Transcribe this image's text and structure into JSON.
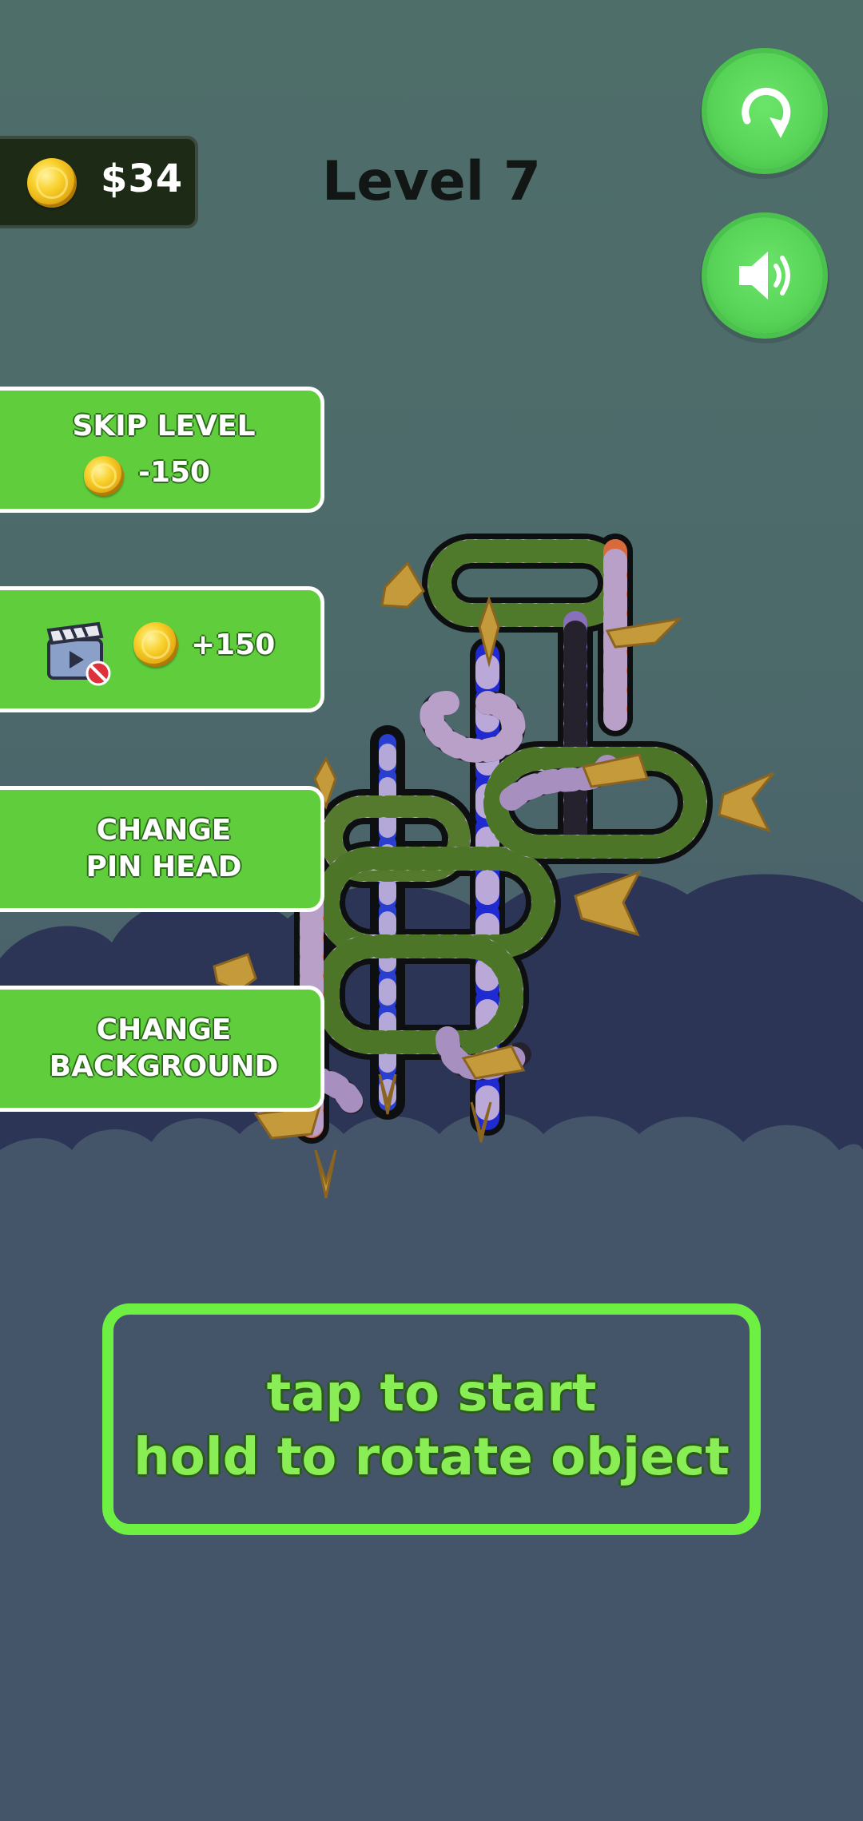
{
  "hud": {
    "coins": "$34",
    "level": "Level 7"
  },
  "buttons": {
    "restart_icon": "restart-icon",
    "sound_icon": "speaker-icon"
  },
  "side_panel": {
    "skip_level": {
      "label": "SKIP LEVEL",
      "cost": "-150"
    },
    "watch_ad": {
      "reward": "+150"
    },
    "change_pin_head": {
      "line1": "CHANGE",
      "line2": "PIN HEAD"
    },
    "change_background": {
      "line1": "CHANGE",
      "line2": "BACKGROUND"
    }
  },
  "hint": {
    "line1": "tap to start",
    "line2": "hold to rotate object"
  },
  "colors": {
    "accent_green": "#5fcd3c",
    "hint_green": "#89ee55",
    "cloud_dark": "#2c3555"
  }
}
